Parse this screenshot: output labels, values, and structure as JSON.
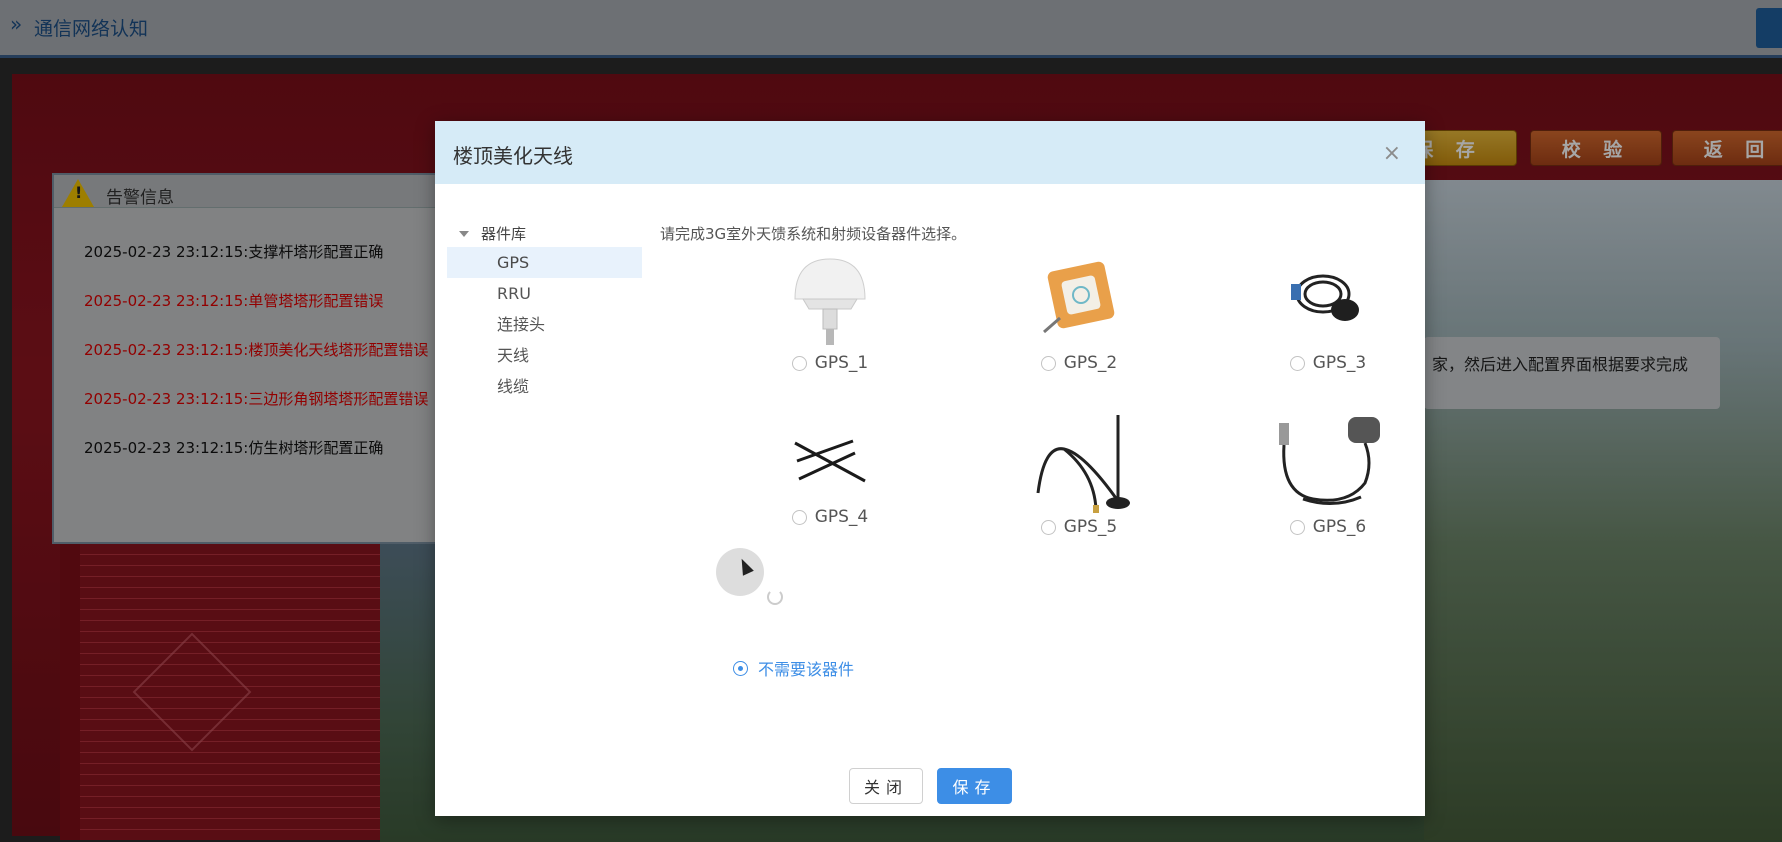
{
  "topbar": {
    "title": "通信网络认知",
    "chevron": "»"
  },
  "scene": {
    "buttons": {
      "save": "保 存",
      "check": "校 验",
      "back": "返 回"
    },
    "hint": "家，然后进入配置界面根据要求完成"
  },
  "alert": {
    "title": "告警信息",
    "messages": [
      {
        "text": "2025-02-23 23:12:15:支撑杆塔形配置正确",
        "status": "ok"
      },
      {
        "text": "2025-02-23 23:12:15:单管塔塔形配置错误",
        "status": "error"
      },
      {
        "text": "2025-02-23 23:12:15:楼顶美化天线塔形配置错误",
        "status": "error"
      },
      {
        "text": "2025-02-23 23:12:15:三边形角钢塔塔形配置错误",
        "status": "error"
      },
      {
        "text": "2025-02-23 23:12:15:仿生树塔形配置正确",
        "status": "ok"
      }
    ]
  },
  "modal": {
    "title": "楼顶美化天线",
    "close_glyph": "×",
    "tree": {
      "root": "器件库",
      "items": [
        "GPS",
        "RRU",
        "连接头",
        "天线",
        "线缆"
      ],
      "selected": "GPS"
    },
    "instruction": "请完成3G室外天馈系统和射频设备器件选择。",
    "options": [
      {
        "label": "GPS_1",
        "icon": "mushroom-antenna-icon",
        "checked": false
      },
      {
        "label": "GPS_2",
        "icon": "patch-antenna-icon",
        "checked": false
      },
      {
        "label": "GPS_3",
        "icon": "puck-antenna-cable-icon",
        "checked": false
      },
      {
        "label": "GPS_4",
        "icon": "rod-antennas-icon",
        "checked": false
      },
      {
        "label": "GPS_5",
        "icon": "whip-antenna-icon",
        "checked": false
      },
      {
        "label": "GPS_6",
        "icon": "usb-gps-receiver-icon",
        "checked": false
      }
    ],
    "none_option": {
      "label": "不需要该器件",
      "checked": true
    },
    "footer": {
      "close": "关闭",
      "save": "保存"
    }
  },
  "colors": {
    "accent": "#3d8ee6",
    "error_text": "#e00000",
    "modal_header": "#d6ebf7"
  }
}
